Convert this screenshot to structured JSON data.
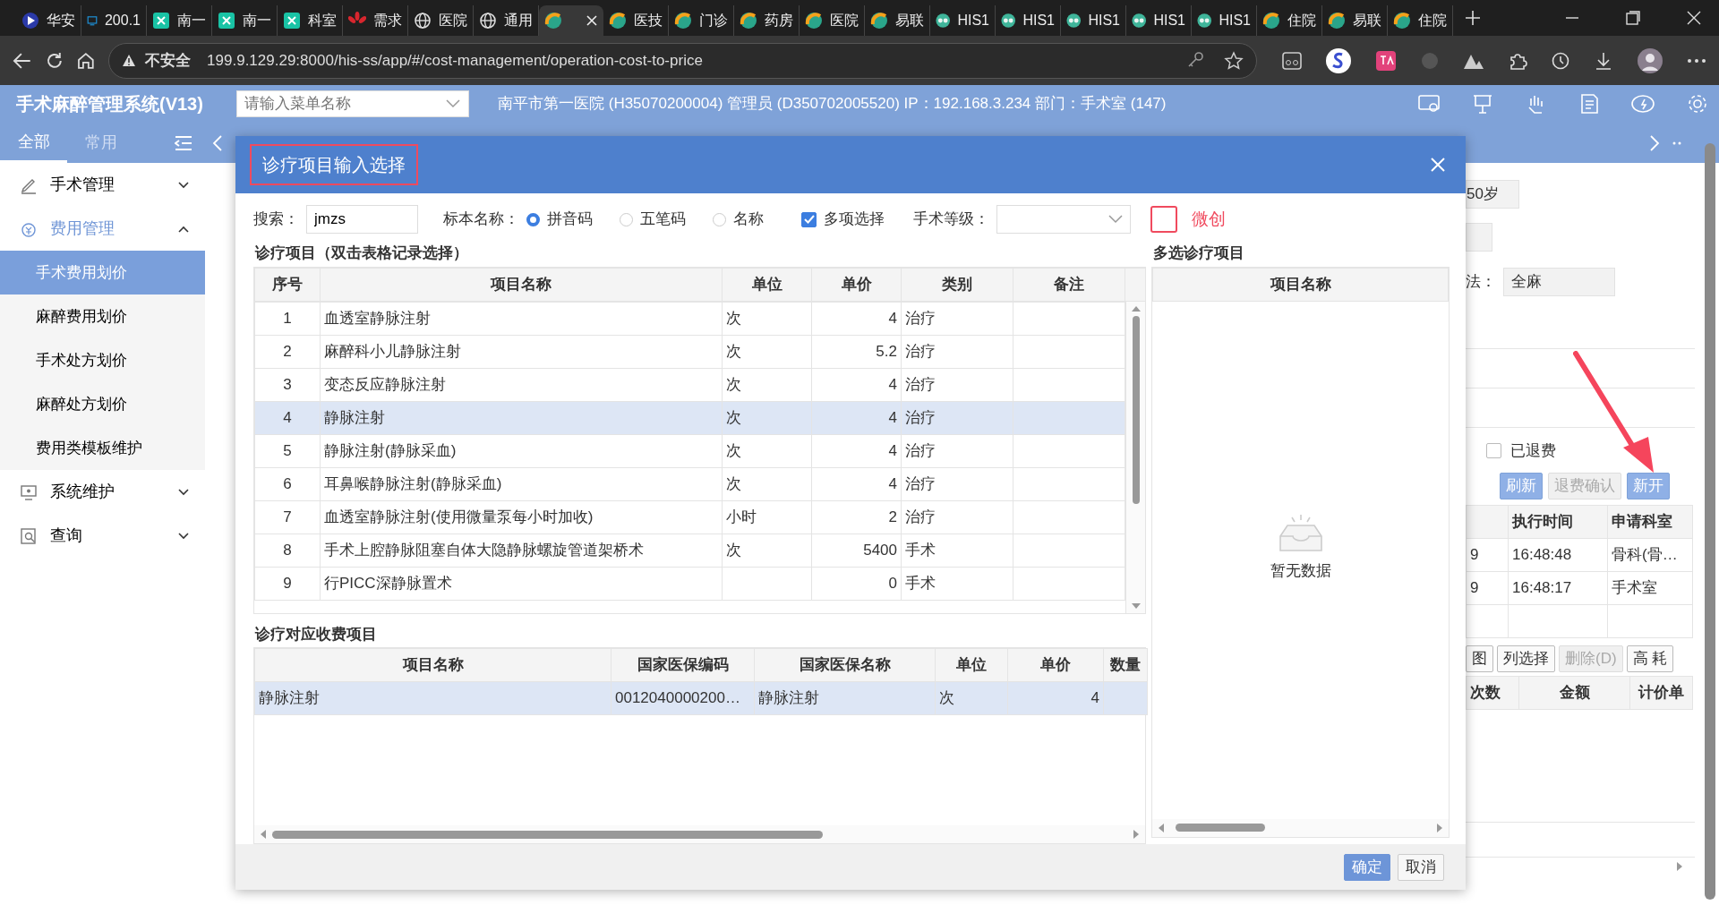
{
  "browser": {
    "tabs": [
      {
        "label": "华安",
        "kind": "play",
        "selected": false
      },
      {
        "label": "200.1",
        "kind": "monitor",
        "selected": false
      },
      {
        "label": "南一",
        "kind": "square",
        "selected": false
      },
      {
        "label": "南一",
        "kind": "square",
        "selected": false
      },
      {
        "label": "科室",
        "kind": "square",
        "selected": false
      },
      {
        "label": "需求",
        "kind": "flower",
        "selected": false
      },
      {
        "label": "医院",
        "kind": "globe",
        "selected": false
      },
      {
        "label": "通用",
        "kind": "globe",
        "selected": false
      },
      {
        "kind": "swirl",
        "selected": true
      },
      {
        "label": "医技",
        "kind": "swirl",
        "selected": false
      },
      {
        "label": "门诊",
        "kind": "swirl",
        "selected": false
      },
      {
        "label": "药房",
        "kind": "swirl",
        "selected": false
      },
      {
        "label": "医院",
        "kind": "swirl",
        "selected": false
      },
      {
        "label": "易联",
        "kind": "swirl",
        "selected": false
      },
      {
        "label": "HIS1",
        "kind": "glasses",
        "selected": false
      },
      {
        "label": "HIS1",
        "kind": "glasses",
        "selected": false
      },
      {
        "label": "HIS1",
        "kind": "glasses",
        "selected": false
      },
      {
        "label": "HIS1",
        "kind": "glasses",
        "selected": false
      },
      {
        "label": "HIS1",
        "kind": "glasses",
        "selected": false
      },
      {
        "label": "住院",
        "kind": "swirl",
        "selected": false
      },
      {
        "label": "易联",
        "kind": "swirl",
        "selected": false
      },
      {
        "label": "住院",
        "kind": "swirl",
        "selected": false
      }
    ],
    "security": "不安全",
    "url": "199.9.129.29:8000/his-ss/app/#/cost-management/operation-cost-to-price"
  },
  "header": {
    "title": "手术麻醉管理系统(V13)",
    "menu_search": {
      "placeholder": "请输入菜单名称"
    },
    "info": "南平市第一医院 (H35070200004) 管理员 (D350702005520) IP：192.168.3.234 部门：手术室 (147)"
  },
  "sidebar": {
    "tabs": [
      {
        "label": "全部",
        "selected": true
      },
      {
        "label": "常用",
        "selected": false
      }
    ],
    "menu": [
      {
        "label": "手术管理",
        "kind": "pen",
        "expanded": false
      },
      {
        "label": "费用管理",
        "kind": "money",
        "expanded": true,
        "children": [
          {
            "label": "手术费用划价",
            "selected": true
          },
          {
            "label": "麻醉费用划价",
            "selected": false
          },
          {
            "label": "手术处方划价",
            "selected": false
          },
          {
            "label": "麻醉处方划价",
            "selected": false
          },
          {
            "label": "费用类模板维护",
            "selected": false
          }
        ]
      },
      {
        "label": "系统维护",
        "kind": "monitor",
        "expanded": false
      },
      {
        "label": "查询",
        "kind": "search",
        "expanded": false
      }
    ]
  },
  "background": {
    "age": "50岁",
    "anesthesia_label": "法：",
    "anesthesia_value": "全麻",
    "refunded": {
      "label": "已退费",
      "checked": false
    },
    "buttons": [
      {
        "label": "刷新",
        "disabled": false
      },
      {
        "label": "退费确认",
        "disabled": true
      },
      {
        "label": "新开",
        "disabled": false
      }
    ],
    "table": {
      "columns": [
        "执行时间",
        "申请科室"
      ],
      "rows": [
        {
          "column_1": "9",
          "time": "16:48:48",
          "department": "骨科(骨…"
        },
        {
          "column_1": "9",
          "time": "16:48:17",
          "department": "手术室"
        }
      ]
    },
    "tools": [
      {
        "label": "图",
        "disabled": false
      },
      {
        "label": "列选择",
        "disabled": false
      },
      {
        "label": "删除(D)",
        "disabled": true
      },
      {
        "label": "高 耗",
        "disabled": false
      }
    ],
    "table2": {
      "columns": [
        "次数",
        "金额",
        "计价单"
      ]
    }
  },
  "dialog": {
    "title": "诊疗项目输入选择",
    "search": {
      "label": "搜索：",
      "value": "jmzs"
    },
    "spec_name": {
      "label": "标本名称：",
      "options": [
        {
          "label": "拼音码",
          "selected": true
        },
        {
          "label": "五笔码",
          "selected": false
        },
        {
          "label": "名称",
          "selected": false
        }
      ]
    },
    "multi_select": {
      "label": "多项选择",
      "checked": true
    },
    "surgery_level": {
      "label": "手术等级："
    },
    "minimally_invasive": {
      "label": "微创",
      "checked": false
    },
    "items": {
      "title": "诊疗项目（双击表格记录选择）",
      "columns": [
        "序号",
        "项目名称",
        "单位",
        "单价",
        "类别",
        "备注"
      ],
      "rows": [
        {
          "no": "1",
          "name": "血透室静脉注射",
          "unit": "次",
          "price": "4",
          "category": "治疗",
          "selected": false
        },
        {
          "no": "2",
          "name": "麻醉科小儿静脉注射",
          "unit": "次",
          "price": "5.2",
          "category": "治疗",
          "selected": false
        },
        {
          "no": "3",
          "name": "变态反应静脉注射",
          "unit": "次",
          "price": "4",
          "category": "治疗",
          "selected": false
        },
        {
          "no": "4",
          "name": "静脉注射",
          "unit": "次",
          "price": "4",
          "category": "治疗",
          "selected": true
        },
        {
          "no": "5",
          "name": "静脉注射(静脉采血)",
          "unit": "次",
          "price": "4",
          "category": "治疗",
          "selected": false
        },
        {
          "no": "6",
          "name": "耳鼻喉静脉注射(静脉采血)",
          "unit": "次",
          "price": "4",
          "category": "治疗",
          "selected": false
        },
        {
          "no": "7",
          "name": "血透室静脉注射(使用微量泵每小时加收)",
          "unit": "小时",
          "price": "2",
          "category": "治疗",
          "selected": false
        },
        {
          "no": "8",
          "name": "手术上腔静脉阻塞自体大隐静脉螺旋管道架桥术",
          "unit": "次",
          "price": "5400",
          "category": "手术",
          "selected": false
        },
        {
          "no": "9",
          "name": "行PICC深静脉置术",
          "price": "0",
          "category": "手术",
          "selected": false
        }
      ]
    },
    "charges": {
      "title": "诊疗对应收费项目",
      "columns": [
        "项目名称",
        "国家医保编码",
        "国家医保名称",
        "单位",
        "单价",
        "数量"
      ],
      "rows": [
        {
          "name": "静脉注射",
          "code": "0012040000200…",
          "insurance_name": "静脉注射",
          "unit": "次",
          "price": "4",
          "selected": true
        }
      ]
    },
    "multi": {
      "title": "多选诊疗项目",
      "columns": [
        "项目名称"
      ],
      "empty_text": "暂无数据"
    },
    "buttons": [
      {
        "label": "确定",
        "kind": "primary"
      },
      {
        "label": "取消",
        "kind": "secondary"
      }
    ]
  }
}
